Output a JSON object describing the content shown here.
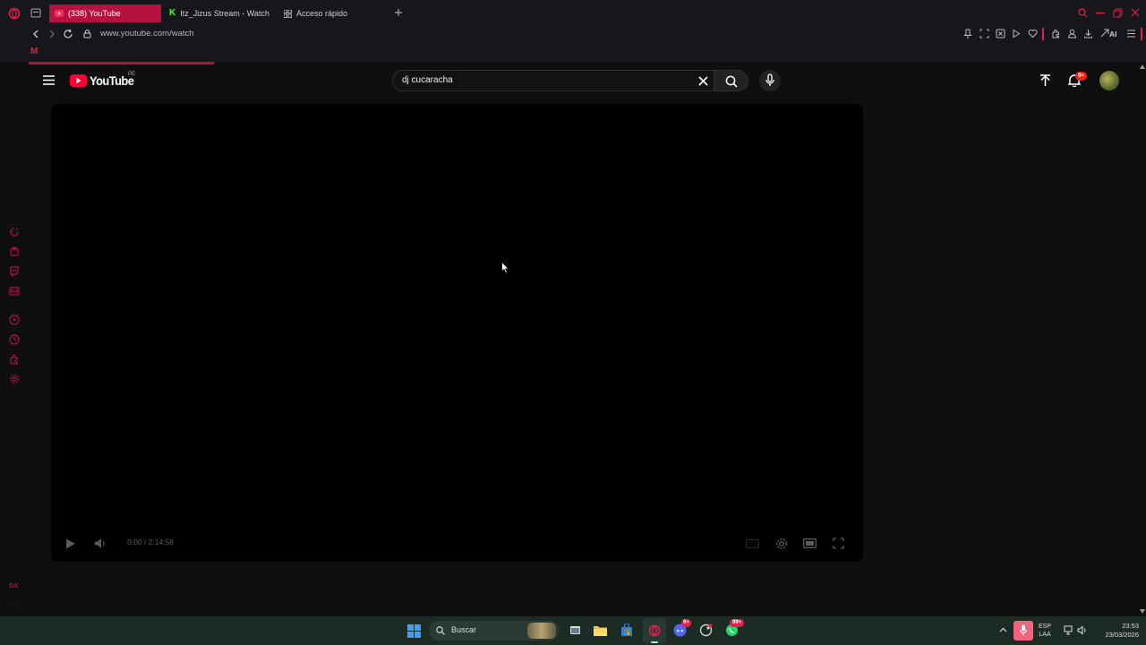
{
  "browser": {
    "tabs": [
      {
        "label": "(338) YouTube",
        "active": true
      },
      {
        "label": "Itz_Jizus Stream - Watch",
        "active": false
      },
      {
        "label": "Acceso rápido",
        "active": false
      }
    ],
    "url": "www.youtube.com/watch",
    "bookmark": "M",
    "ai_label": "AI",
    "accent": "#b5123f",
    "sidebar_bottom": "GX",
    "sidebar_more": "···"
  },
  "youtube": {
    "logo": "YouTube",
    "region": "PE",
    "search_value": "dj cucaracha",
    "notifications_badge": "9+",
    "player": {
      "time_current": "0:00",
      "time_separator": "/",
      "time_total": "2:14:58",
      "progress_fraction": 0
    }
  },
  "taskbar": {
    "search_placeholder": "Buscar",
    "lang_line1": "ESP",
    "lang_line2": "LAA",
    "time": "23:53",
    "date": "23/03/2026",
    "discord_badge": "9+",
    "whatsapp_badge": "99+"
  }
}
